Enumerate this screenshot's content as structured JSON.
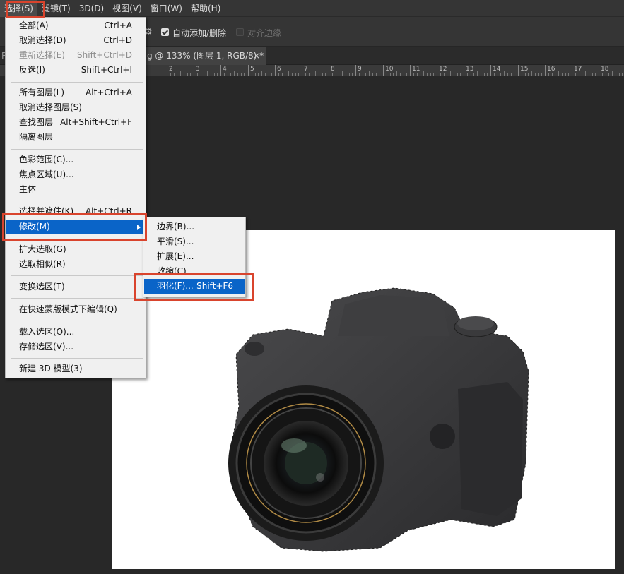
{
  "menubar": {
    "items": [
      "选择(S)",
      "滤镜(T)",
      "3D(D)",
      "视图(V)",
      "窗口(W)",
      "帮助(H)"
    ]
  },
  "options": {
    "auto_add_delete": "自动添加/删除",
    "align_edges": "对齐边缘"
  },
  "tabs": {
    "left_partial": "Ro",
    "doc_title": "g @ 133% (图层 1, RGB/8) *",
    "close": "×"
  },
  "ruler": {
    "labels": [
      "2",
      "3",
      "4",
      "5",
      "6",
      "7",
      "8",
      "9",
      "10",
      "11",
      "12",
      "13",
      "14",
      "15",
      "16",
      "17",
      "18"
    ]
  },
  "select_menu": {
    "items": [
      {
        "label": "全部(A)",
        "shortcut": "Ctrl+A",
        "disabled": false
      },
      {
        "label": "取消选择(D)",
        "shortcut": "Ctrl+D",
        "disabled": false
      },
      {
        "label": "重新选择(E)",
        "shortcut": "Shift+Ctrl+D",
        "disabled": true
      },
      {
        "label": "反选(I)",
        "shortcut": "Shift+Ctrl+I",
        "disabled": false
      },
      {
        "label": "所有图层(L)",
        "shortcut": "Alt+Ctrl+A",
        "disabled": false
      },
      {
        "label": "取消选择图层(S)",
        "shortcut": "",
        "disabled": false
      },
      {
        "label": "查找图层",
        "shortcut": "Alt+Shift+Ctrl+F",
        "disabled": false
      },
      {
        "label": "隔离图层",
        "shortcut": "",
        "disabled": false
      },
      {
        "label": "色彩范围(C)...",
        "shortcut": "",
        "disabled": false
      },
      {
        "label": "焦点区域(U)...",
        "shortcut": "",
        "disabled": false
      },
      {
        "label": "主体",
        "shortcut": "",
        "disabled": false
      },
      {
        "label": "选择并遮住(K)...",
        "shortcut": "Alt+Ctrl+R",
        "disabled": false
      },
      {
        "label": "修改(M)",
        "shortcut": "",
        "disabled": false
      },
      {
        "label": "扩大选取(G)",
        "shortcut": "",
        "disabled": false
      },
      {
        "label": "选取相似(R)",
        "shortcut": "",
        "disabled": false
      },
      {
        "label": "变换选区(T)",
        "shortcut": "",
        "disabled": false
      },
      {
        "label": "在快速蒙版模式下编辑(Q)",
        "shortcut": "",
        "disabled": false
      },
      {
        "label": "载入选区(O)...",
        "shortcut": "",
        "disabled": false
      },
      {
        "label": "存储选区(V)...",
        "shortcut": "",
        "disabled": false
      },
      {
        "label": "新建 3D 模型(3)",
        "shortcut": "",
        "disabled": false
      }
    ]
  },
  "modify_menu": {
    "items": [
      {
        "label": "边界(B)...",
        "shortcut": ""
      },
      {
        "label": "平滑(S)...",
        "shortcut": ""
      },
      {
        "label": "扩展(E)...",
        "shortcut": ""
      },
      {
        "label": "收缩(C)...",
        "shortcut": ""
      },
      {
        "label": "羽化(F)...",
        "shortcut": "Shift+F6"
      }
    ]
  },
  "colors": {
    "highlight": "#0a64c8",
    "annotation": "#d9442d",
    "workspace": "#282828"
  }
}
